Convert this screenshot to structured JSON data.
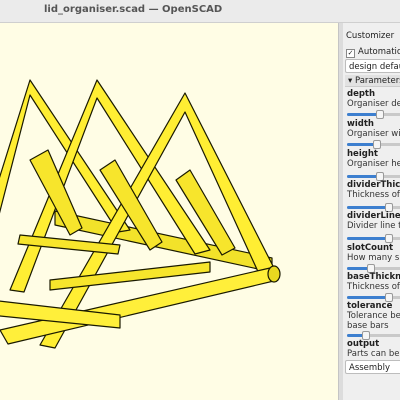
{
  "window": {
    "title": "lid_organiser.scad — OpenSCAD"
  },
  "customizer": {
    "header": "Customizer",
    "auto_preview_label": "Automatic P",
    "preset_value": "design default",
    "parameters_header": "Parameters",
    "params": [
      {
        "name": "depth",
        "desc": "Organiser dep",
        "level": 0.55
      },
      {
        "name": "width",
        "desc": "Organiser widt",
        "level": 0.5
      },
      {
        "name": "height",
        "desc": "Organiser heig",
        "level": 0.55
      },
      {
        "name": "dividerThickne",
        "desc": "Thickness of th",
        "level": 0.7
      },
      {
        "name": "dividerLineTh",
        "desc": "Divider line thi",
        "level": 0.7
      },
      {
        "name": "slotCount",
        "desc": "How many slot",
        "level": 0.4
      },
      {
        "name": "baseThicknes",
        "desc": "Thickness of th",
        "level": 0.7
      },
      {
        "name": "tolerance",
        "desc": "Tolerance betw",
        "desc2": "base bars",
        "level": 0.3
      },
      {
        "name": "output",
        "desc": "Parts can be pr"
      }
    ],
    "output_value": "Assembly"
  },
  "colors": {
    "model": "#ffee33",
    "outline": "#1a1a00",
    "viewport_bg": "#fffde5",
    "accent": "#3d7fcf"
  }
}
